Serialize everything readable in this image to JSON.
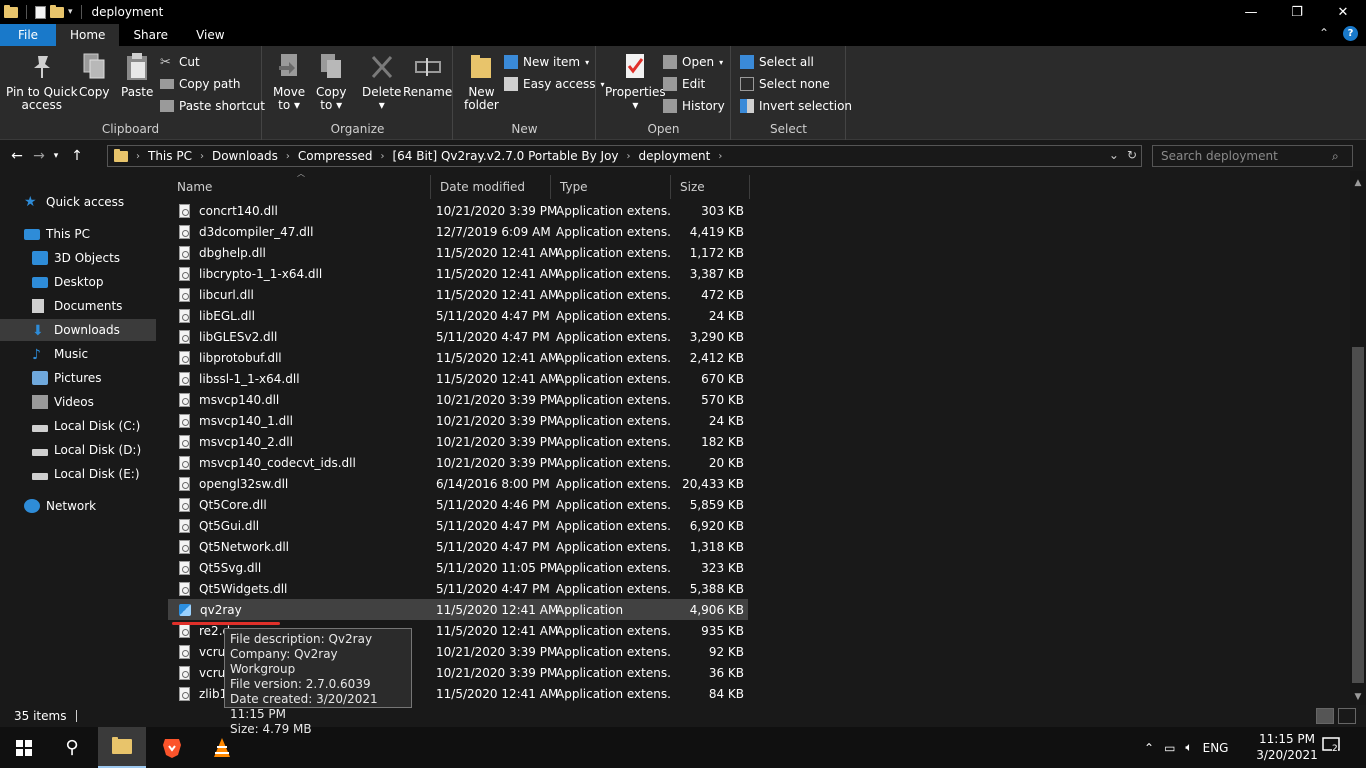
{
  "window": {
    "title": "deployment",
    "controls": {
      "minimize": "—",
      "maximize": "❐",
      "close": "✕"
    }
  },
  "tabs": [
    {
      "label": "File"
    },
    {
      "label": "Home"
    },
    {
      "label": "Share"
    },
    {
      "label": "View"
    }
  ],
  "ribbon": {
    "clipboard": {
      "label": "Clipboard",
      "pin": "Pin to Quick access",
      "pin_l1": "Pin to Quick",
      "pin_l2": "access",
      "copy": "Copy",
      "paste": "Paste",
      "cut": "Cut",
      "copy_path": "Copy path",
      "paste_shortcut": "Paste shortcut"
    },
    "organize": {
      "label": "Organize",
      "move_l1": "Move",
      "move_l2": "to",
      "copy_l1": "Copy",
      "copy_l2": "to",
      "delete": "Delete",
      "rename": "Rename"
    },
    "new": {
      "label": "New",
      "new_folder_l1": "New",
      "new_folder_l2": "folder",
      "new_item": "New item",
      "easy_access": "Easy access"
    },
    "open": {
      "label": "Open",
      "properties": "Properties",
      "open": "Open",
      "edit": "Edit",
      "history": "History"
    },
    "select": {
      "label": "Select",
      "select_all": "Select all",
      "select_none": "Select none",
      "invert": "Invert selection"
    }
  },
  "address": {
    "crumbs": [
      "This PC",
      "Downloads",
      "Compressed",
      "[64 Bit] Qv2ray.v2.7.0 Portable By Joy",
      "deployment"
    ],
    "search_placeholder": "Search deployment"
  },
  "navpane": {
    "quick_access": "Quick access",
    "this_pc": "This PC",
    "items": [
      "3D Objects",
      "Desktop",
      "Documents",
      "Downloads",
      "Music",
      "Pictures",
      "Videos",
      "Local Disk (C:)",
      "Local Disk (D:)",
      "Local Disk (E:)"
    ],
    "network": "Network"
  },
  "columns": {
    "name": "Name",
    "date": "Date modified",
    "type": "Type",
    "size": "Size"
  },
  "files": [
    {
      "name": "concrt140.dll",
      "date": "10/21/2020 3:39 PM",
      "type": "Application extens...",
      "size": "303 KB"
    },
    {
      "name": "d3dcompiler_47.dll",
      "date": "12/7/2019 6:09 AM",
      "type": "Application extens...",
      "size": "4,419 KB"
    },
    {
      "name": "dbghelp.dll",
      "date": "11/5/2020 12:41 AM",
      "type": "Application extens...",
      "size": "1,172 KB"
    },
    {
      "name": "libcrypto-1_1-x64.dll",
      "date": "11/5/2020 12:41 AM",
      "type": "Application extens...",
      "size": "3,387 KB"
    },
    {
      "name": "libcurl.dll",
      "date": "11/5/2020 12:41 AM",
      "type": "Application extens...",
      "size": "472 KB"
    },
    {
      "name": "libEGL.dll",
      "date": "5/11/2020 4:47 PM",
      "type": "Application extens...",
      "size": "24 KB"
    },
    {
      "name": "libGLESv2.dll",
      "date": "5/11/2020 4:47 PM",
      "type": "Application extens...",
      "size": "3,290 KB"
    },
    {
      "name": "libprotobuf.dll",
      "date": "11/5/2020 12:41 AM",
      "type": "Application extens...",
      "size": "2,412 KB"
    },
    {
      "name": "libssl-1_1-x64.dll",
      "date": "11/5/2020 12:41 AM",
      "type": "Application extens...",
      "size": "670 KB"
    },
    {
      "name": "msvcp140.dll",
      "date": "10/21/2020 3:39 PM",
      "type": "Application extens...",
      "size": "570 KB"
    },
    {
      "name": "msvcp140_1.dll",
      "date": "10/21/2020 3:39 PM",
      "type": "Application extens...",
      "size": "24 KB"
    },
    {
      "name": "msvcp140_2.dll",
      "date": "10/21/2020 3:39 PM",
      "type": "Application extens...",
      "size": "182 KB"
    },
    {
      "name": "msvcp140_codecvt_ids.dll",
      "date": "10/21/2020 3:39 PM",
      "type": "Application extens...",
      "size": "20 KB"
    },
    {
      "name": "opengl32sw.dll",
      "date": "6/14/2016 8:00 PM",
      "type": "Application extens...",
      "size": "20,433 KB"
    },
    {
      "name": "Qt5Core.dll",
      "date": "5/11/2020 4:46 PM",
      "type": "Application extens...",
      "size": "5,859 KB"
    },
    {
      "name": "Qt5Gui.dll",
      "date": "5/11/2020 4:47 PM",
      "type": "Application extens...",
      "size": "6,920 KB"
    },
    {
      "name": "Qt5Network.dll",
      "date": "5/11/2020 4:47 PM",
      "type": "Application extens...",
      "size": "1,318 KB"
    },
    {
      "name": "Qt5Svg.dll",
      "date": "5/11/2020 11:05 PM",
      "type": "Application extens...",
      "size": "323 KB"
    },
    {
      "name": "Qt5Widgets.dll",
      "date": "5/11/2020 4:47 PM",
      "type": "Application extens...",
      "size": "5,388 KB"
    },
    {
      "name": "qv2ray",
      "date": "11/5/2020 12:41 AM",
      "type": "Application",
      "size": "4,906 KB"
    },
    {
      "name": "re2.d",
      "date": "11/5/2020 12:41 AM",
      "type": "Application extens...",
      "size": "935 KB"
    },
    {
      "name": "vcrun",
      "date": "10/21/2020 3:39 PM",
      "type": "Application extens...",
      "size": "92 KB"
    },
    {
      "name": "vcrun",
      "date": "10/21/2020 3:39 PM",
      "type": "Application extens...",
      "size": "36 KB"
    },
    {
      "name": "zlib1.",
      "date": "11/5/2020 12:41 AM",
      "type": "Application extens...",
      "size": "84 KB"
    }
  ],
  "tooltip": {
    "desc": "File description: Qv2ray",
    "company": "Company: Qv2ray Workgroup",
    "version": "File version: 2.7.0.6039",
    "created": "Date created: 3/20/2021 11:15 PM",
    "size": "Size: 4.79 MB"
  },
  "status": {
    "items": "35 items"
  },
  "taskbar": {
    "lang": "ENG",
    "time": "11:15 PM",
    "date": "3/20/2021",
    "notifications": "2"
  },
  "colors": {
    "accent": "#1979ca",
    "highlight_underline": "#e0302a"
  }
}
